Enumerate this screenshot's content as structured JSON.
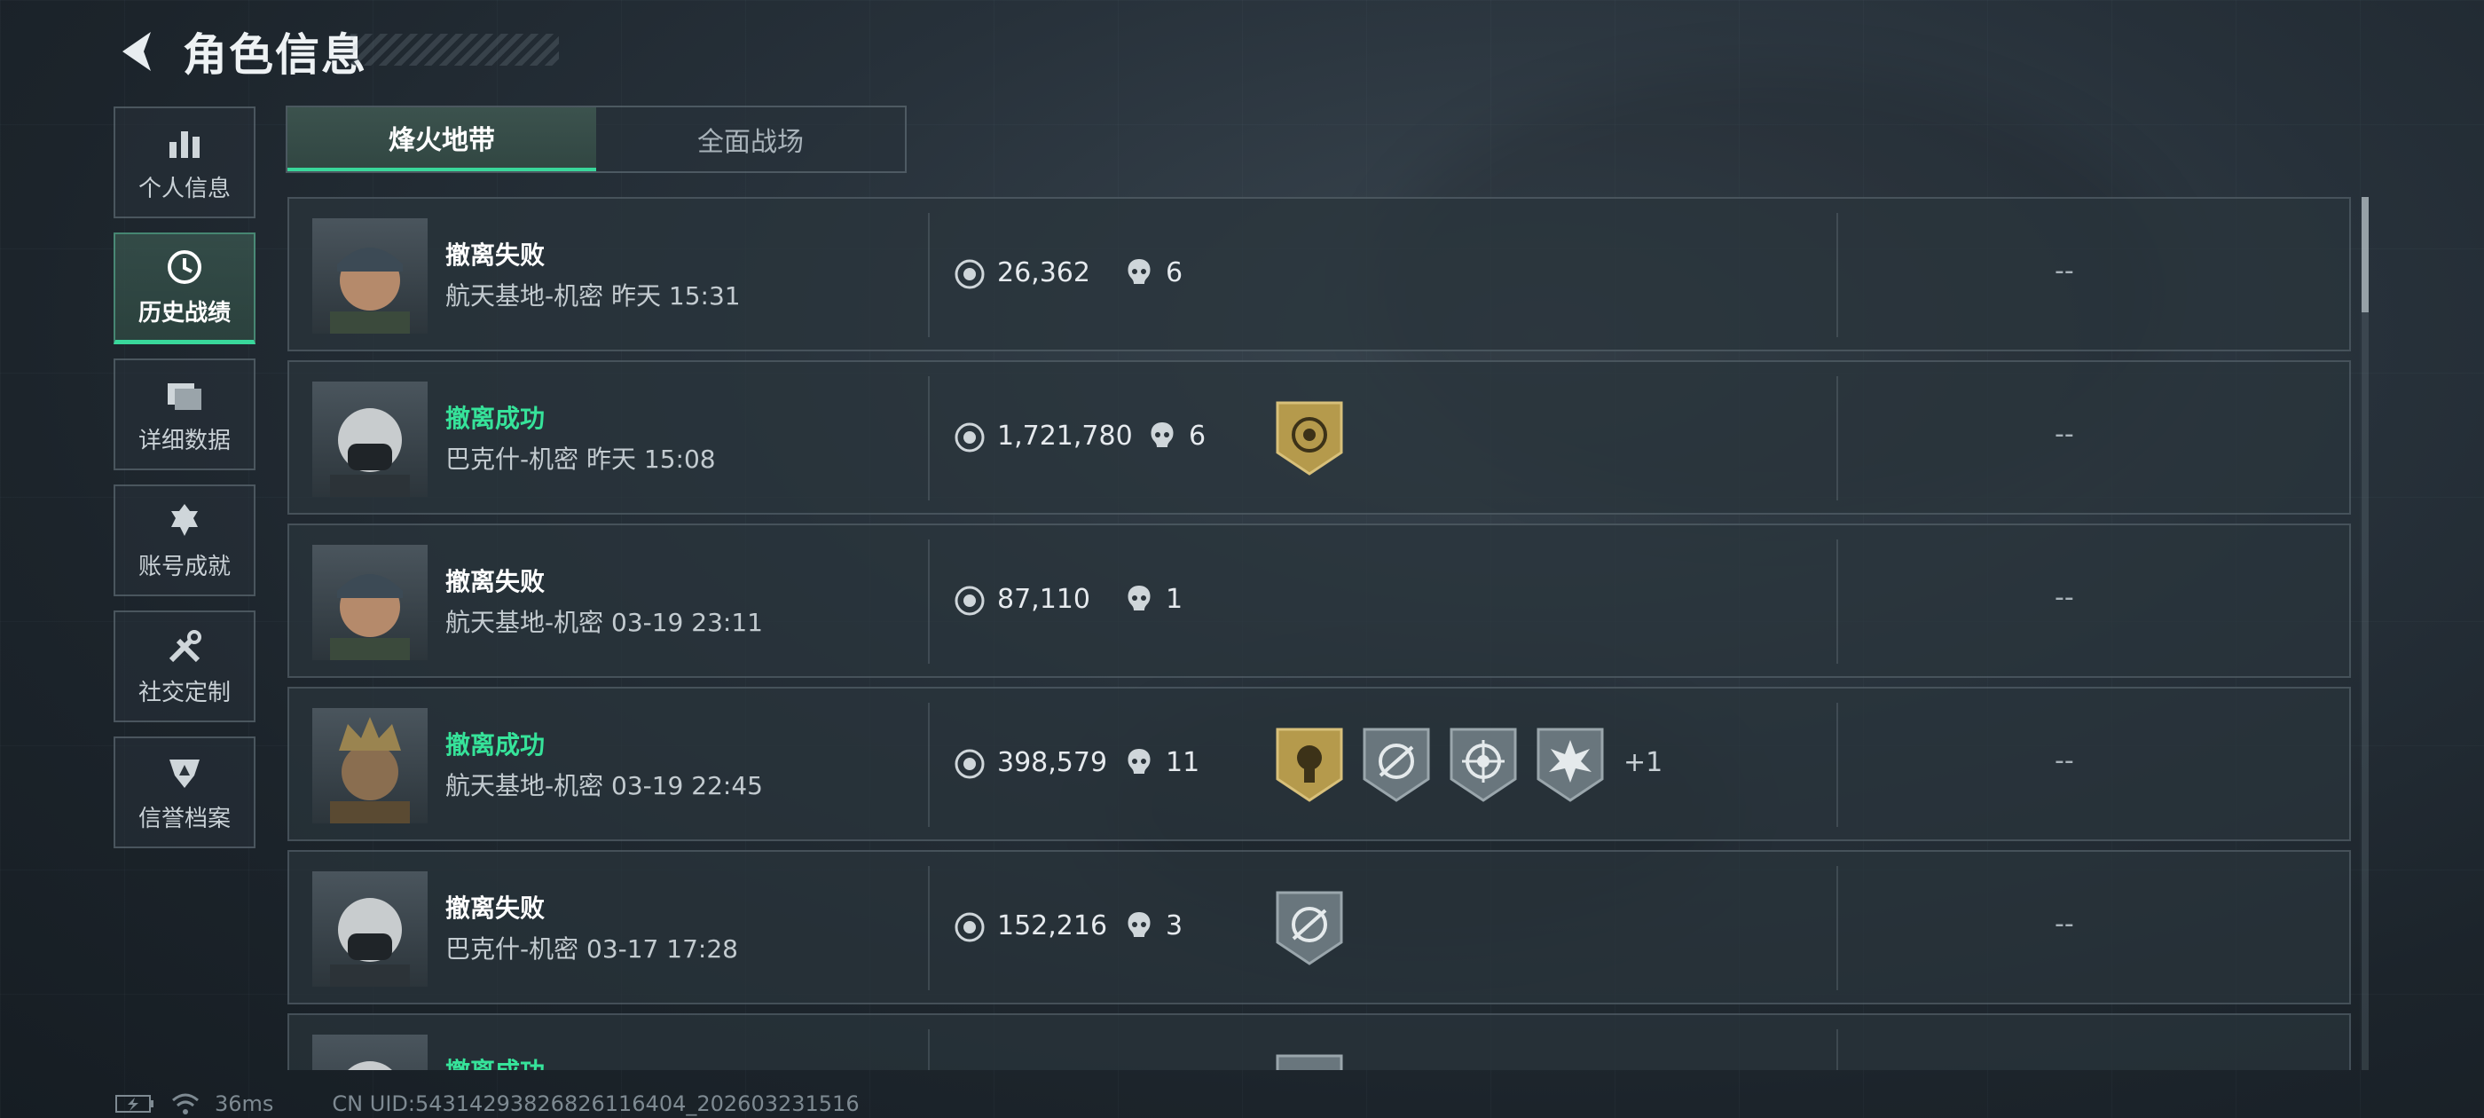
{
  "header": {
    "title": "角色信息"
  },
  "sidebar": {
    "items": [
      {
        "label": "个人信息",
        "icon": "bar-chart-icon",
        "active": false
      },
      {
        "label": "历史战绩",
        "icon": "history-clock-icon",
        "active": true
      },
      {
        "label": "详细数据",
        "icon": "folders-icon",
        "active": false
      },
      {
        "label": "账号成就",
        "icon": "achievement-icon",
        "active": false
      },
      {
        "label": "社交定制",
        "icon": "tools-icon",
        "active": false
      },
      {
        "label": "信誉档案",
        "icon": "shield-emblem-icon",
        "active": false
      }
    ]
  },
  "tabs": [
    {
      "label": "烽火地带",
      "active": true
    },
    {
      "label": "全面战场",
      "active": false
    }
  ],
  "records": [
    {
      "status": "撤离失败",
      "success": false,
      "meta": "航天基地-机密 昨天 15:31",
      "value": "26,362",
      "kills": "6",
      "extra": "--"
    },
    {
      "status": "撤离成功",
      "success": true,
      "meta": "巴克什-机密 昨天 15:08",
      "value": "1,721,780",
      "kills": "6",
      "extra": "--"
    },
    {
      "status": "撤离失败",
      "success": false,
      "meta": "航天基地-机密 03-19 23:11",
      "value": "87,110",
      "kills": "1",
      "extra": "--"
    },
    {
      "status": "撤离成功",
      "success": true,
      "meta": "航天基地-机密 03-19 22:45",
      "value": "398,579",
      "kills": "11",
      "extra": "--",
      "more": "+1"
    },
    {
      "status": "撤离失败",
      "success": false,
      "meta": "巴克什-机密 03-17 17:28",
      "value": "152,216",
      "kills": "3",
      "extra": "--"
    },
    {
      "status": "撤离成功",
      "success": true
    }
  ],
  "footer": {
    "ping": "36ms",
    "uid": "CN UID:54314293826826116404_202603231516"
  },
  "colors": {
    "accent": "#39d79b",
    "success": "#36e39a",
    "gold": "#b59a4c",
    "badge_grey": "#69767d"
  }
}
